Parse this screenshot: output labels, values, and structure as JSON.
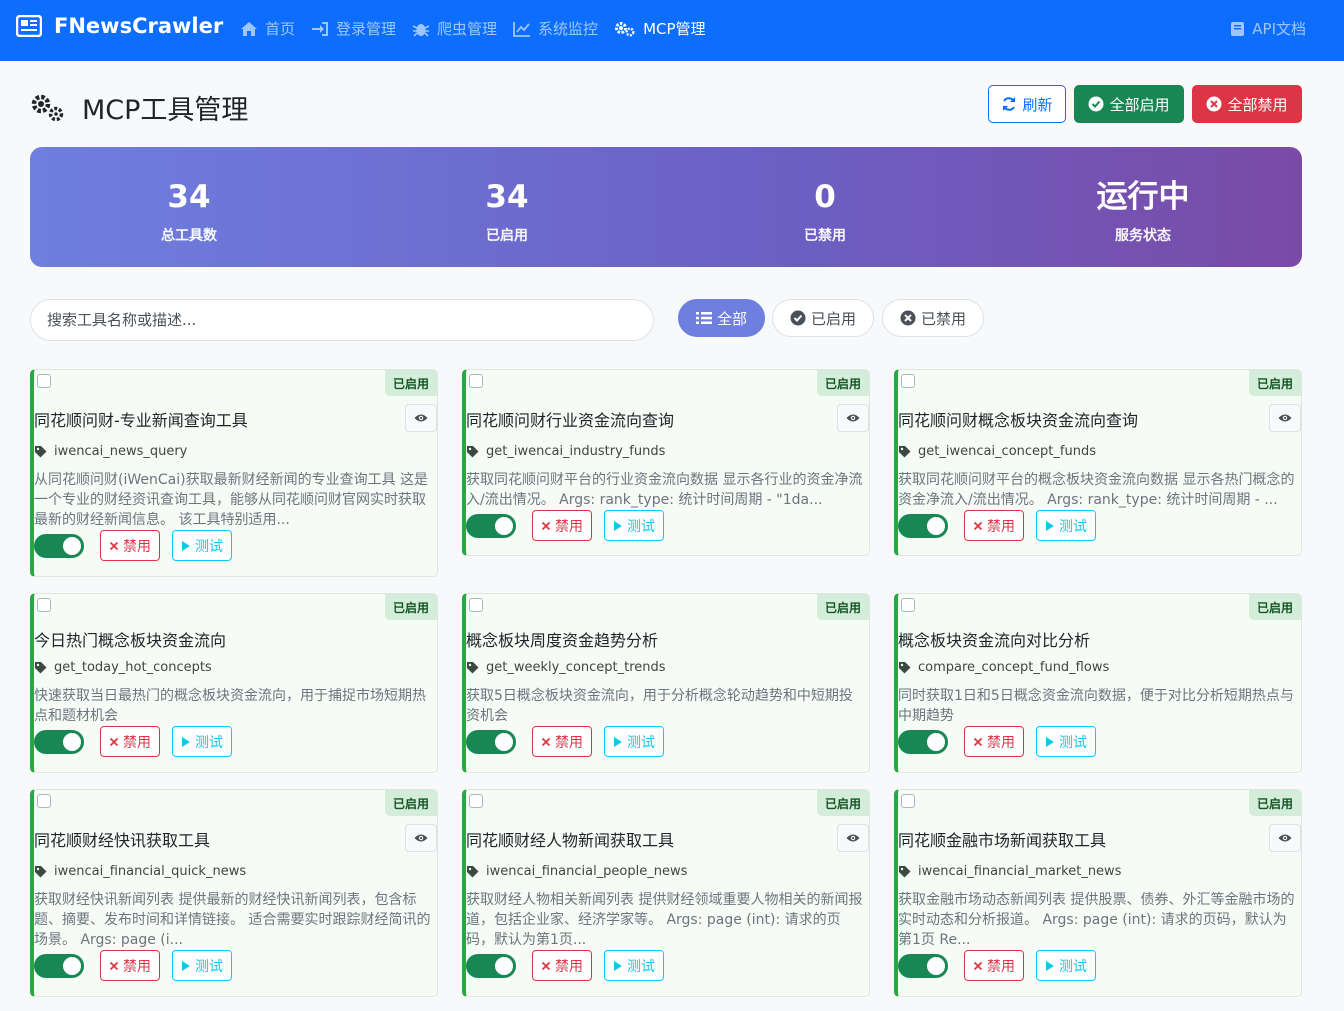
{
  "nav": {
    "brand": "FNewsCrawler",
    "items": [
      {
        "label": "首页",
        "icon": "home-icon"
      },
      {
        "label": "登录管理",
        "icon": "sign-in-icon"
      },
      {
        "label": "爬虫管理",
        "icon": "bug-icon"
      },
      {
        "label": "系统监控",
        "icon": "chart-line-icon"
      },
      {
        "label": "MCP管理",
        "icon": "cogs-icon"
      }
    ],
    "api_docs": "API文档"
  },
  "header": {
    "title": "MCP工具管理",
    "refresh": "刷新",
    "enable_all": "全部启用",
    "disable_all": "全部禁用"
  },
  "stats": [
    {
      "value": "34",
      "label": "总工具数"
    },
    {
      "value": "34",
      "label": "已启用"
    },
    {
      "value": "0",
      "label": "已禁用"
    },
    {
      "value": "运行中",
      "label": "服务状态"
    }
  ],
  "search": {
    "placeholder": "搜索工具名称或描述..."
  },
  "filters": {
    "all": "全部",
    "enabled": "已启用",
    "disabled": "已禁用"
  },
  "colors": {
    "primary": "#0d6efd",
    "success": "#198754",
    "danger": "#dc3545",
    "info": "#0dcaf0",
    "gradient_start": "#6f7fdf",
    "gradient_end": "#7a4ba6"
  },
  "cards": [
    {
      "badge": "已启用",
      "title": "同花顺问财-专业新闻查询工具",
      "fn": "iwencai_news_query",
      "desc": "从同花顺问财(iWenCai)获取最新财经新闻的专业查询工具 这是一个专业的财经资讯查询工具，能够从同花顺问财官网实时获取最新的财经新闻信息。 该工具特别适用...",
      "disable": "禁用",
      "test": "测试",
      "has_eye": true
    },
    {
      "badge": "已启用",
      "title": "同花顺问财行业资金流向查询",
      "fn": "get_iwencai_industry_funds",
      "desc": "获取同花顺问财平台的行业资金流向数据 显示各行业的资金净流入/流出情况。 Args: rank_type: 统计时间周期 - \"1da...",
      "disable": "禁用",
      "test": "测试",
      "has_eye": true
    },
    {
      "badge": "已启用",
      "title": "同花顺问财概念板块资金流向查询",
      "fn": "get_iwencai_concept_funds",
      "desc": "获取同花顺问财平台的概念板块资金流向数据 显示各热门概念的资金净流入/流出情况。 Args: rank_type: 统计时间周期 - ...",
      "disable": "禁用",
      "test": "测试",
      "has_eye": true
    },
    {
      "badge": "已启用",
      "title": "今日热门概念板块资金流向",
      "fn": "get_today_hot_concepts",
      "desc": "快速获取当日最热门的概念板块资金流向，用于捕捉市场短期热点和题材机会",
      "disable": "禁用",
      "test": "测试",
      "has_eye": false
    },
    {
      "badge": "已启用",
      "title": "概念板块周度资金趋势分析",
      "fn": "get_weekly_concept_trends",
      "desc": "获取5日概念板块资金流向，用于分析概念轮动趋势和中短期投资机会",
      "disable": "禁用",
      "test": "测试",
      "has_eye": false
    },
    {
      "badge": "已启用",
      "title": "概念板块资金流向对比分析",
      "fn": "compare_concept_fund_flows",
      "desc": "同时获取1日和5日概念资金流向数据，便于对比分析短期热点与中期趋势",
      "disable": "禁用",
      "test": "测试",
      "has_eye": false
    },
    {
      "badge": "已启用",
      "title": "同花顺财经快讯获取工具",
      "fn": "iwencai_financial_quick_news",
      "desc": "获取财经快讯新闻列表 提供最新的财经快讯新闻列表，包含标题、摘要、发布时间和详情链接。 适合需要实时跟踪财经简讯的场景。 Args: page (i...",
      "disable": "禁用",
      "test": "测试",
      "has_eye": true
    },
    {
      "badge": "已启用",
      "title": "同花顺财经人物新闻获取工具",
      "fn": "iwencai_financial_people_news",
      "desc": "获取财经人物相关新闻列表 提供财经领域重要人物相关的新闻报道，包括企业家、经济学家等。 Args: page (int): 请求的页码，默认为第1页...",
      "disable": "禁用",
      "test": "测试",
      "has_eye": true
    },
    {
      "badge": "已启用",
      "title": "同花顺金融市场新闻获取工具",
      "fn": "iwencai_financial_market_news",
      "desc": "获取金融市场动态新闻列表 提供股票、债券、外汇等金融市场的实时动态和分析报道。 Args: page (int): 请求的页码，默认为第1页 Re...",
      "disable": "禁用",
      "test": "测试",
      "has_eye": true
    }
  ]
}
